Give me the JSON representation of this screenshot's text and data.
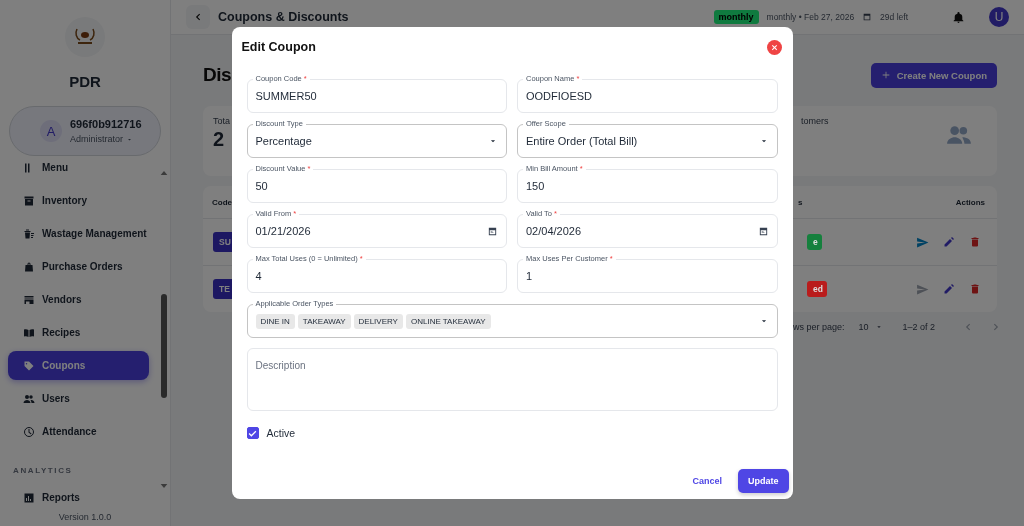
{
  "sidebar": {
    "brand": "PDR",
    "user": {
      "avatar": "A",
      "name": "696f0b912716",
      "role": "Administrator"
    },
    "items": [
      {
        "label": "Menu",
        "selected": false
      },
      {
        "label": "Inventory",
        "selected": false
      },
      {
        "label": "Wastage Management",
        "selected": false
      },
      {
        "label": "Purchase Orders",
        "selected": false
      },
      {
        "label": "Vendors",
        "selected": false
      },
      {
        "label": "Recipes",
        "selected": false
      },
      {
        "label": "Coupons",
        "selected": true
      },
      {
        "label": "Users",
        "selected": false
      },
      {
        "label": "Attendance",
        "selected": false
      }
    ],
    "section": "ANALYTICS",
    "section_items": [
      {
        "label": "Reports",
        "selected": false
      }
    ],
    "version": "Version 1.0.0"
  },
  "topbar": {
    "title": "Coupons & Discounts",
    "plan_badge": "monthly",
    "plan_info": "monthly • Feb 27, 2026",
    "days_left": "29d left",
    "avatar": "U"
  },
  "page": {
    "heading": "Dis",
    "create_button": "Create New Coupon",
    "stats": [
      {
        "label": "Tota",
        "value": "2"
      },
      {
        "label": "tomers"
      }
    ],
    "table": {
      "columns": [
        "Code",
        "s",
        "Actions"
      ],
      "rows": [
        {
          "code": "SU",
          "status": "e",
          "color": "#15803d",
          "send_disabled": false
        },
        {
          "code": "TE",
          "status": "ed",
          "color": "#b91c1c",
          "send_disabled": true
        }
      ]
    },
    "pagination": {
      "rows_label": "ws per page:",
      "rows_value": "10",
      "range": "1–2 of 2"
    }
  },
  "dialog": {
    "title": "Edit Coupon",
    "fields": [
      {
        "kind": "text",
        "label": "Coupon Code",
        "required_mark": "*",
        "value": "SUMMER50"
      },
      {
        "kind": "text",
        "label": "Coupon Name",
        "required_mark": "*",
        "value": "OODFIOESD"
      },
      {
        "kind": "select",
        "label": "Discount Type",
        "value": "Percentage"
      },
      {
        "kind": "select",
        "label": "Offer Scope",
        "value": "Entire Order (Total Bill)"
      },
      {
        "kind": "text",
        "label": "Discount Value",
        "required_mark": "*",
        "value": "50"
      },
      {
        "kind": "text",
        "label": "Min Bill Amount",
        "required_mark": "*",
        "value": "150"
      },
      {
        "kind": "date",
        "label": "Valid From",
        "required_mark": "*",
        "value": "01/21/2026"
      },
      {
        "kind": "date",
        "label": "Valid To",
        "required_mark": "*",
        "value": "02/04/2026"
      },
      {
        "kind": "text",
        "label": "Max Total Uses (0 = Unlimited)",
        "required_mark": "*",
        "value": "4"
      },
      {
        "kind": "text",
        "label": "Max Uses Per Customer",
        "required_mark": "*",
        "value": "1"
      }
    ],
    "order_types": {
      "label": "Applicable Order Types",
      "chips": [
        "DINE IN",
        "TAKEAWAY",
        "DELIVERY",
        "ONLINE TAKEAWAY"
      ]
    },
    "description": {
      "placeholder": "Description"
    },
    "active": {
      "label": "Active",
      "checked": true
    },
    "cancel": "Cancel",
    "submit": "Update"
  }
}
